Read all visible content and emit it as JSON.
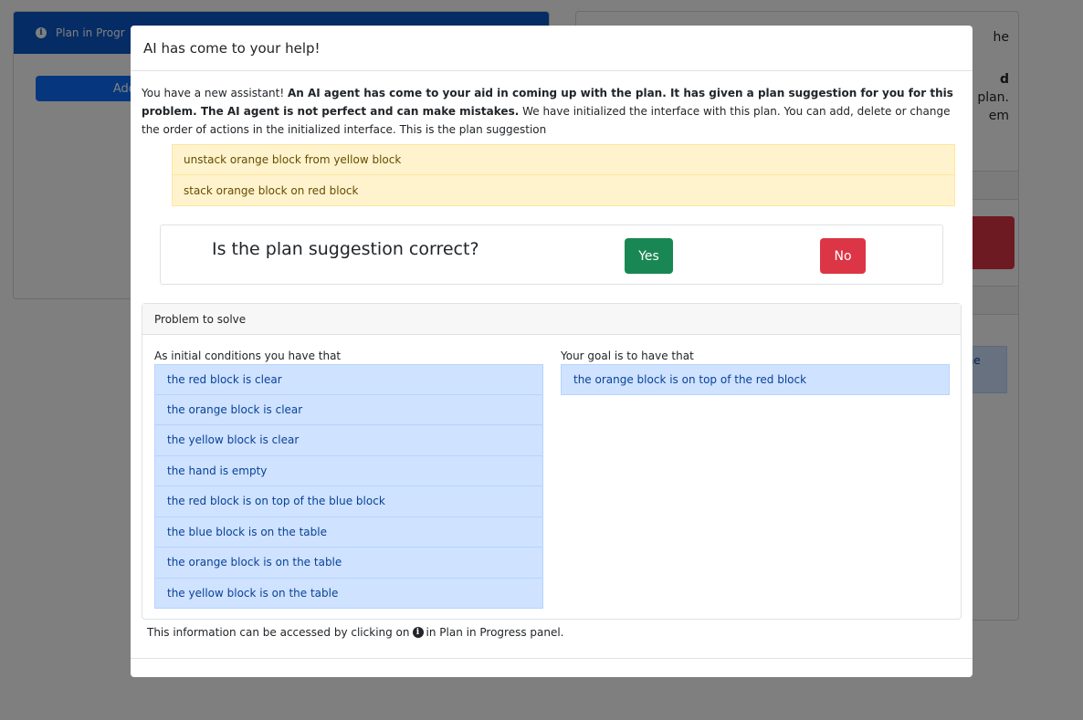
{
  "background": {
    "left_panel": {
      "header_title": "Plan in Progr",
      "add_button_label": "Add"
    },
    "right_panel": {
      "text_1": "he",
      "text_2": "d",
      "text_3": "plan.",
      "text_4": "em",
      "blue_text": "the"
    }
  },
  "modal": {
    "title": "AI has come to your help!",
    "intro": {
      "part1": "You have a new assistant! ",
      "bold": "An AI agent has come to your aid in coming up with the plan. It has given a plan suggestion for you for this problem. The AI agent is not perfect and can make mistakes.",
      "part2": " We have initialized the interface with this plan. You can add, delete or change the order of actions in the initialized interface. This is the plan suggestion"
    },
    "suggestions": [
      "unstack orange block from yellow block",
      "stack orange block on red block"
    ],
    "question": "Is the plan suggestion correct?",
    "yes_label": "Yes",
    "no_label": "No",
    "problem": {
      "header": "Problem to solve",
      "initial_label": "As initial conditions you have that",
      "goal_label": "Your goal is to have that",
      "initial_conditions": [
        "the red block is clear",
        "the orange block is clear",
        "the yellow block is clear",
        "the hand is empty",
        "the red block is on top of the blue block",
        "the blue block is on the table",
        "the orange block is on the table",
        "the yellow block is on the table"
      ],
      "goals": [
        "the orange block is on top of the red block"
      ]
    },
    "footer": {
      "before": "This information can be accessed by clicking on",
      "icon": "info-circle-icon",
      "after": "in Plan in Progress panel."
    }
  },
  "colors": {
    "overlay": "rgba(0,0,0,0.5)",
    "yes": "#198754",
    "no": "#dc3545",
    "suggestion_bg": "#fff3cd",
    "condition_bg": "#cfe2ff"
  }
}
